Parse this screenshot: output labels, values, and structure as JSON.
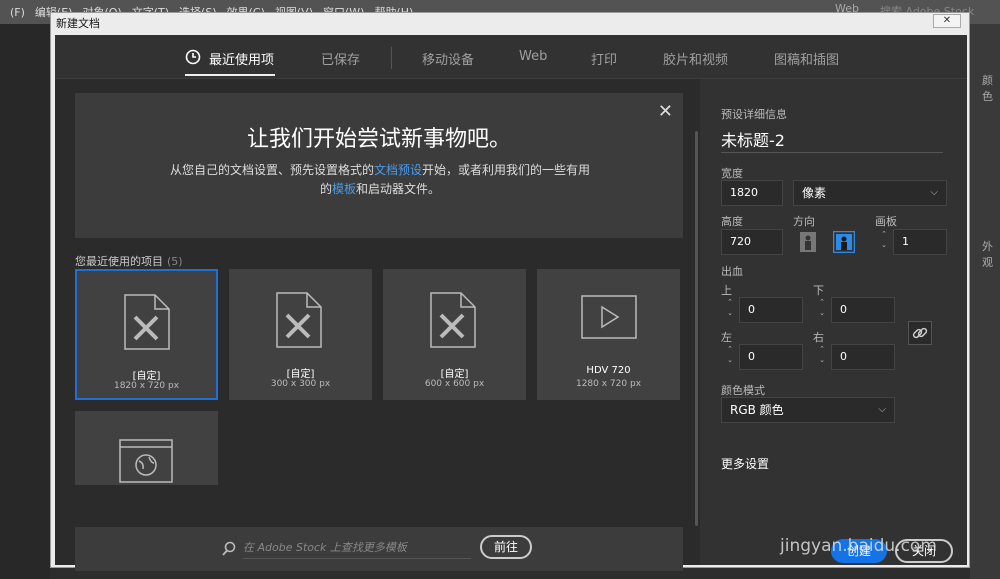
{
  "app": {
    "menu": [
      "(F)",
      "编辑(E)",
      "对象(O)",
      "文字(T)",
      "选择(S)",
      "效果(C)",
      "视图(V)",
      "窗口(W)",
      "帮助(H)"
    ],
    "right_text": "Web",
    "right_text2": "搜索 Adobe Stock",
    "panel_labels": [
      "颜色",
      "外观"
    ]
  },
  "dialog": {
    "title": "新建文档",
    "close_label": "✕"
  },
  "tabs": [
    "最近使用项",
    "已保存",
    "移动设备",
    "Web",
    "打印",
    "胶片和视频",
    "图稿和插图"
  ],
  "hero": {
    "title": "让我们开始尝试新事物吧。",
    "desc_part1": "从您自己的文档设置、预先设置格式的",
    "desc_link1": "文档预设",
    "desc_part2": "开始，或者利用我们的一些有用的",
    "desc_link2": "模板",
    "desc_part3": "和启动器文件。"
  },
  "recent": {
    "title": "您最近使用的项目",
    "count": "(5)",
    "items": [
      {
        "name": "[自定]",
        "size": "1820 x 720 px",
        "icon": "document-brush-icon"
      },
      {
        "name": "[自定]",
        "size": "300 x 300 px",
        "icon": "document-brush-icon"
      },
      {
        "name": "[自定]",
        "size": "600 x 600 px",
        "icon": "document-brush-icon"
      },
      {
        "name": "HDV 720",
        "size": "1280 x 720 px",
        "icon": "video-play-icon"
      },
      {
        "name": "",
        "size": "",
        "icon": "web-globe-icon"
      }
    ]
  },
  "search": {
    "placeholder": "在 Adobe Stock 上查找更多模板",
    "go_label": "前往"
  },
  "preset": {
    "section_label": "预设详细信息",
    "name": "未标题-2",
    "width_label": "宽度",
    "width": "1820",
    "unit": "像素",
    "height_label": "高度",
    "height": "720",
    "orientation_label": "方向",
    "artboards_label": "画板",
    "artboards": "1",
    "bleed_label": "出血",
    "top_label": "上",
    "top": "0",
    "bottom_label": "下",
    "bottom": "0",
    "left_label": "左",
    "left": "0",
    "right_label": "右",
    "right": "0",
    "color_mode_label": "颜色模式",
    "color_mode": "RGB 颜色",
    "more_settings": "更多设置"
  },
  "buttons": {
    "create": "创建",
    "close": "关闭"
  },
  "watermark": "jingyan.baidu.com"
}
